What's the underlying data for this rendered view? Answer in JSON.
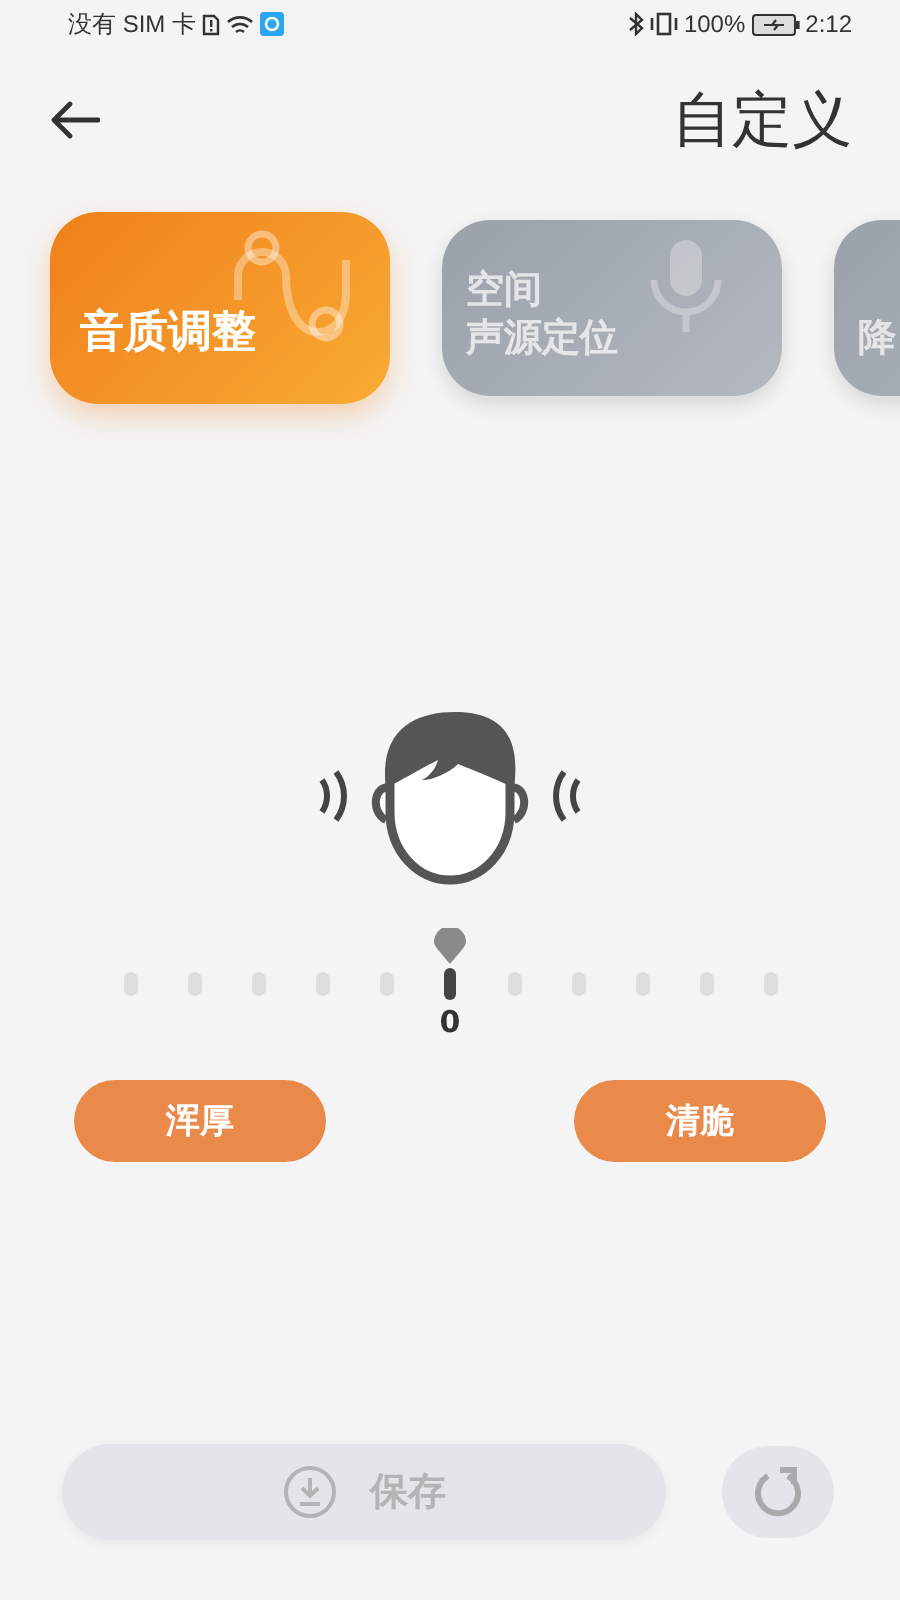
{
  "status_bar": {
    "carrier": "没有 SIM 卡",
    "battery": "100%",
    "time": "2:12"
  },
  "header": {
    "title": "自定义"
  },
  "modes": [
    {
      "lines": [
        "音质调整"
      ],
      "selected": true,
      "kind": "curve"
    },
    {
      "lines": [
        "空间",
        "声源定位"
      ],
      "selected": false,
      "kind": "mic"
    },
    {
      "lines": [
        "降"
      ],
      "selected": false,
      "kind": "plain"
    }
  ],
  "slider": {
    "level": 0.5,
    "reading": "0"
  },
  "presets": [
    "浑厚",
    "清脆"
  ],
  "save": {
    "label": "保存",
    "disabled": true
  }
}
